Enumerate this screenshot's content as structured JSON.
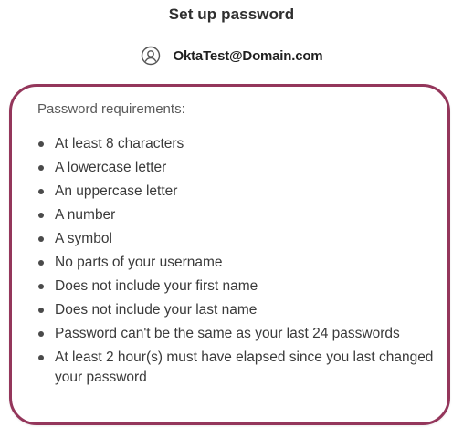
{
  "header": {
    "title": "Set up password"
  },
  "user": {
    "icon": "user-circle-icon",
    "username": "OktaTest@Domain.com"
  },
  "requirements": {
    "heading": "Password requirements:",
    "items": [
      "At least 8 characters",
      "A lowercase letter",
      "An uppercase letter",
      "A number",
      "A symbol",
      "No parts of your username",
      "Does not include your first name",
      "Does not include your last name",
      "Password can't be the same as your last 24 passwords",
      "At least 2 hour(s) must have elapsed since you last changed your password"
    ]
  },
  "colors": {
    "box_border": "#94365b",
    "text": "#3a3a3a"
  }
}
